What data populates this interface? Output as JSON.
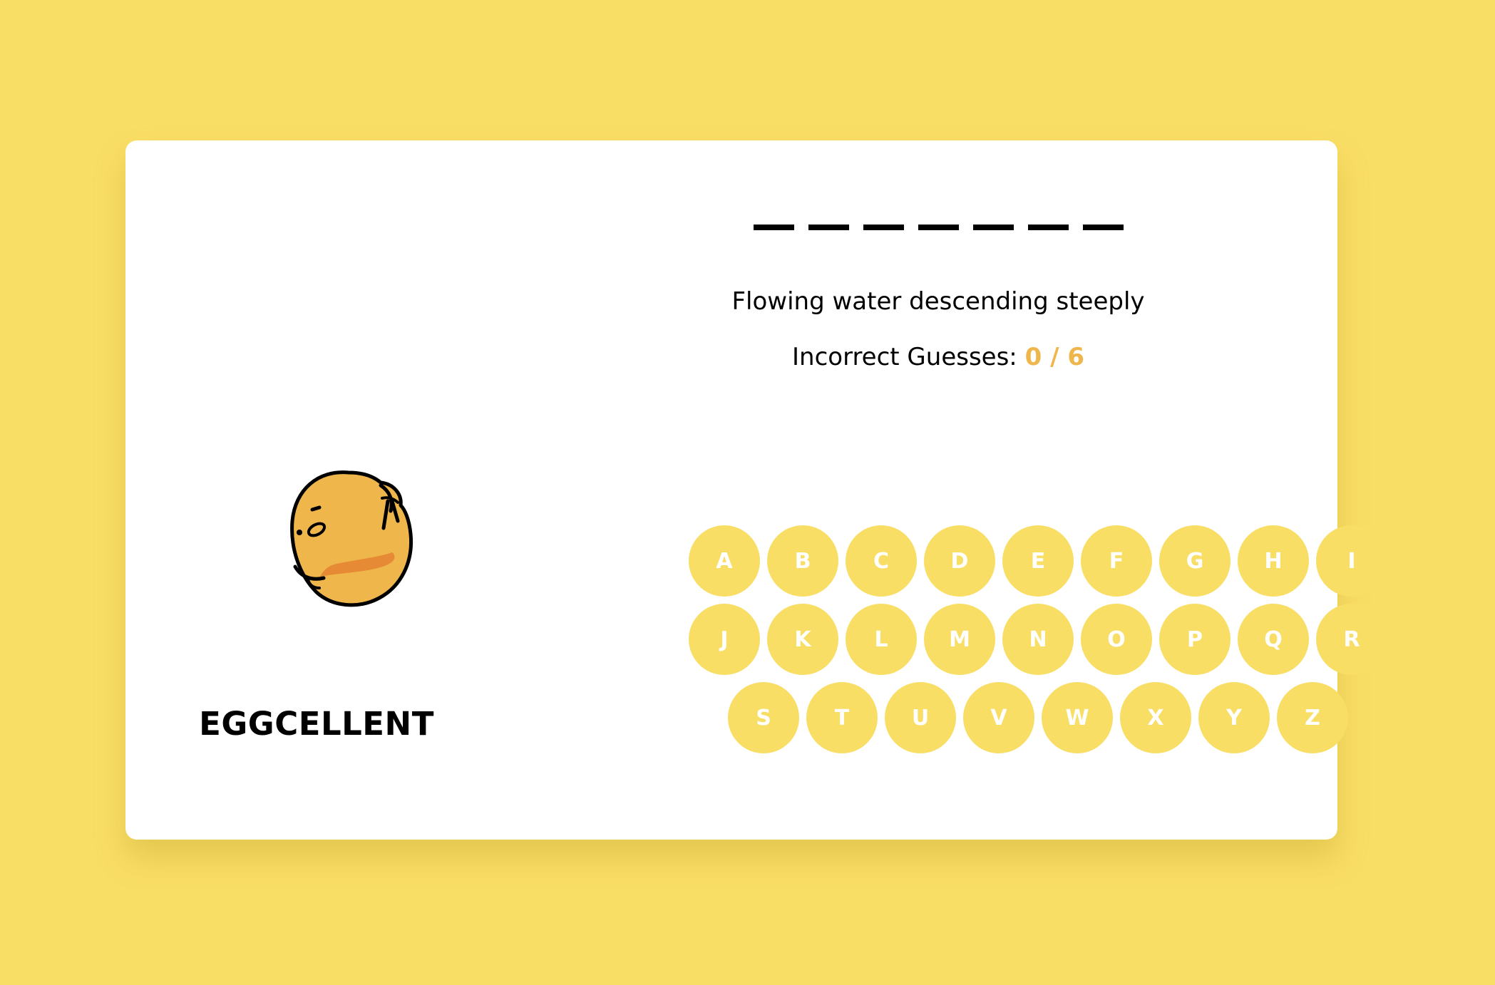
{
  "game": {
    "title": "EGGCELLENT",
    "mascot": "egg-yolk-mascot",
    "word_length": 7,
    "hint": "Flowing water descending steeply",
    "guesses_label": "Incorrect Guesses:",
    "guesses_value": "0 / 6",
    "accent_color": "#efb64b",
    "key_color": "#f9de66",
    "background_color": "#f9de66"
  },
  "keyboard": {
    "rows": [
      [
        "A",
        "B",
        "C",
        "D",
        "E",
        "F",
        "G",
        "H",
        "I"
      ],
      [
        "J",
        "K",
        "L",
        "M",
        "N",
        "O",
        "P",
        "Q",
        "R"
      ],
      [
        "S",
        "T",
        "U",
        "V",
        "W",
        "X",
        "Y",
        "Z"
      ]
    ]
  }
}
